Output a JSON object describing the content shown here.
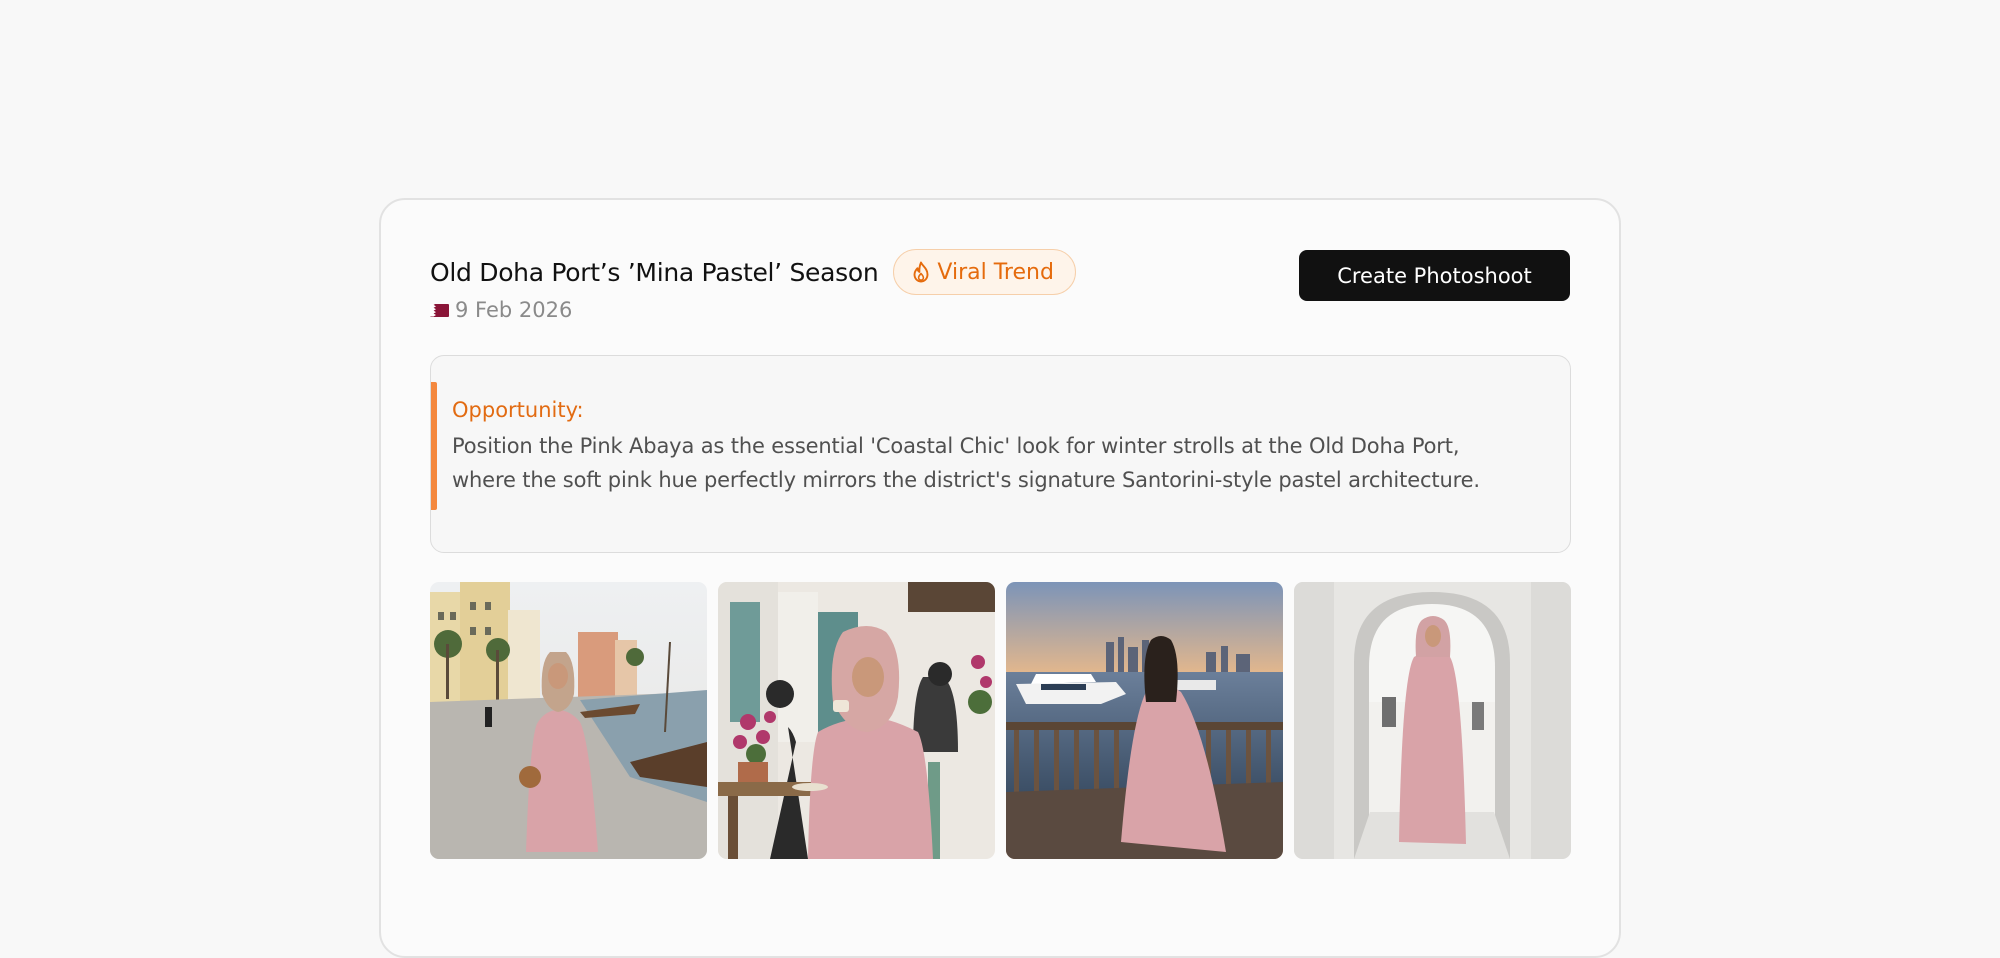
{
  "card": {
    "title": "Old Doha Port’s ’Mina Pastel’ Season",
    "badge": {
      "label": "Viral Trend",
      "icon": "flame-icon"
    },
    "date": {
      "flag_icon": "qatar-flag-icon",
      "text": "9 Feb 2026"
    },
    "create_button_label": "Create Photoshoot"
  },
  "opportunity": {
    "label": "Opportunity:",
    "text": "Position the Pink Abaya as the essential 'Coastal Chic' look for winter strolls at the Old Doha Port, where the soft pink hue perfectly mirrors the district's signature Santorini-style pastel architecture."
  },
  "gallery": {
    "images": [
      {
        "alt": "woman-pink-abaya-walking-port-promenade"
      },
      {
        "alt": "woman-pink-abaya-cafe-with-cup"
      },
      {
        "alt": "woman-pink-abaya-railing-sunset-skyline"
      },
      {
        "alt": "woman-pink-abaya-white-archway"
      }
    ]
  },
  "colors": {
    "accent_orange": "#e56b0d",
    "badge_bg": "#fef4ea",
    "button_bg": "#111111",
    "abaya_pink": "#d9a3a8"
  }
}
